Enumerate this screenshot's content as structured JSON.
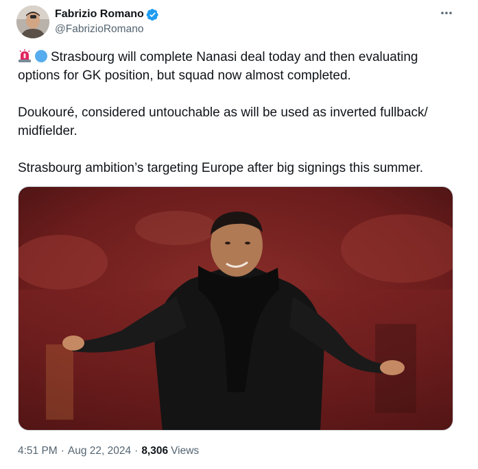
{
  "author": {
    "display_name": "Fabrizio Romano",
    "handle": "@FabrizioRomano",
    "verified": true
  },
  "tweet": {
    "paragraphs": [
      "Strasbourg will complete Nanasi deal today and then evaluating options for GK position, but squad now almost completed.",
      "Doukouré, considered untouchable as will be used as inverted fullback/ midfielder.",
      "Strasbourg ambition’s targeting Europe after big signings this summer."
    ],
    "leading_emojis": [
      "siren-emoji",
      "blue-circle-emoji"
    ]
  },
  "footer": {
    "time": "4:51 PM",
    "separator": "·",
    "date": "Aug 22, 2024",
    "views_count": "8,306",
    "views_label": "Views"
  },
  "colors": {
    "text": "#0f1419",
    "secondary": "#536471",
    "verified": "#1d9bf0",
    "border": "#cfd9de"
  }
}
